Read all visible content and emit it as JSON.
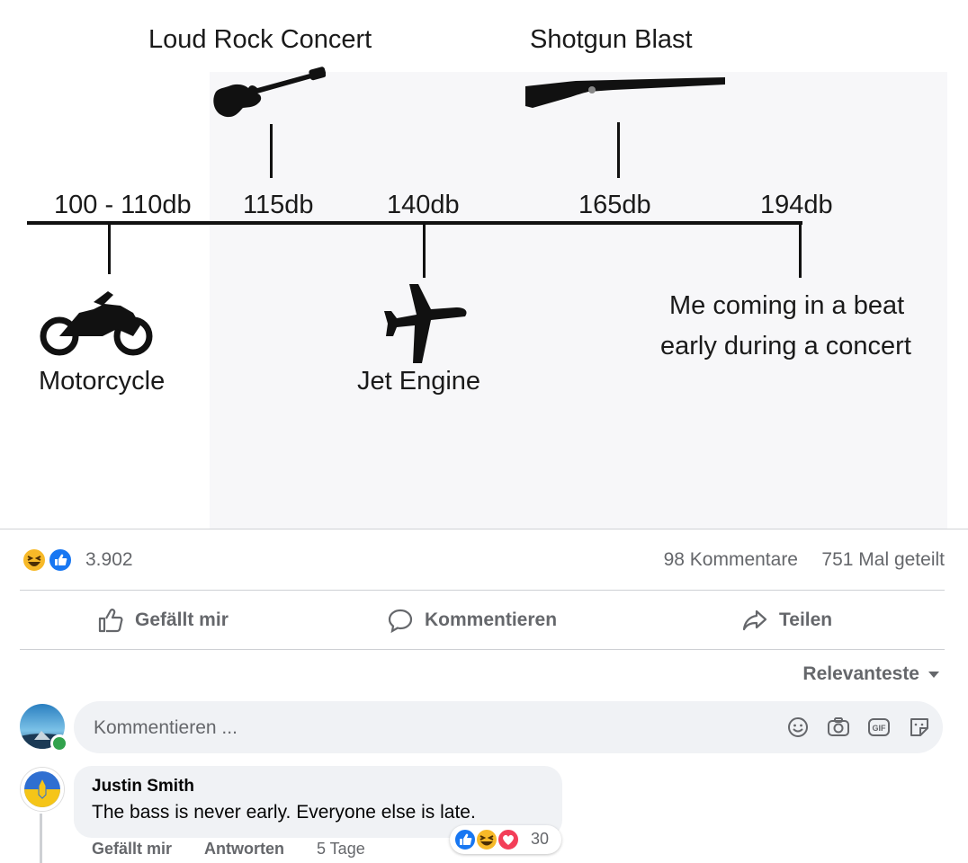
{
  "meme": {
    "top_labels": [
      "Loud Rock Concert",
      "Shotgun Blast"
    ],
    "db_values": [
      "100 - 110db",
      "115db",
      "140db",
      "165db",
      "194db"
    ],
    "bottom_labels": [
      "Motorcycle",
      "Jet Engine"
    ],
    "caption_lines": [
      "Me coming in a beat",
      "early during a concert"
    ],
    "icons": [
      "guitar-icon",
      "shotgun-icon",
      "motorcycle-icon",
      "airplane-icon"
    ]
  },
  "post_stats": {
    "reaction_count": "3.902",
    "reaction_types": [
      "haha",
      "like"
    ],
    "comments": "98 Kommentare",
    "shares": "751 Mal geteilt"
  },
  "actions": {
    "like": "Gefällt mir",
    "comment": "Kommentieren",
    "share": "Teilen"
  },
  "sort": {
    "label": "Relevanteste"
  },
  "composer": {
    "placeholder": "Kommentieren ...",
    "icons": [
      "smiley-icon",
      "camera-icon",
      "gif-icon",
      "sticker-icon"
    ]
  },
  "comment": {
    "author": "Justin Smith",
    "text": "The bass is never early. Everyone else is late.",
    "like_label": "Gefällt mir",
    "reply_label": "Antworten",
    "age": "5 Tage",
    "reaction_count": "30",
    "reaction_types": [
      "like",
      "haha",
      "love"
    ]
  },
  "colors": {
    "like_blue": "#1877f2",
    "haha_yellow": "#f7b928",
    "love_red": "#f33e58",
    "secondary_text": "#65676b",
    "input_bg": "#f0f2f5",
    "online_green": "#31a24c"
  }
}
